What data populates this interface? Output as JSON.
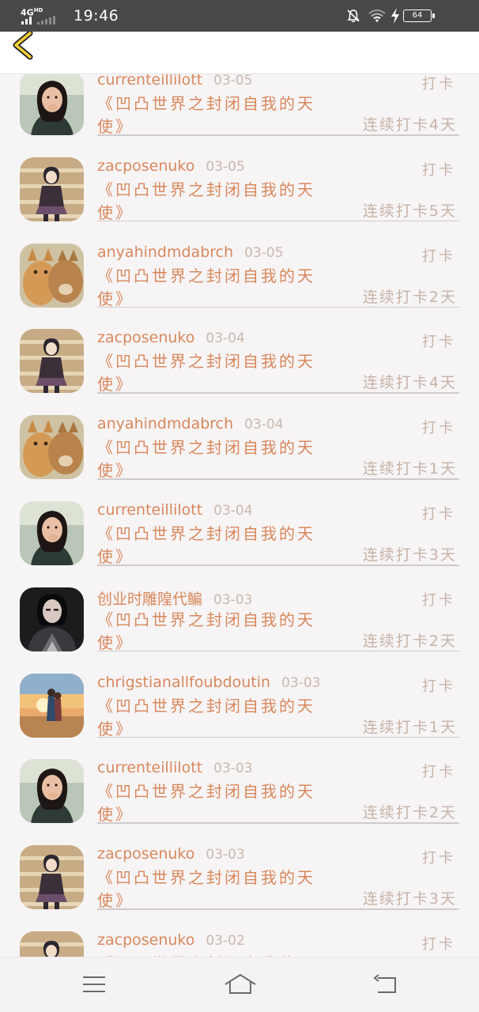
{
  "status_bar": {
    "network": "4G",
    "network_sup": "HD",
    "time": "19:46",
    "battery": "64",
    "icons": [
      "signal-icon",
      "mute-icon",
      "wifi-icon",
      "charging-icon",
      "battery-icon"
    ]
  },
  "header": {
    "back_icon": "chevron-left-icon"
  },
  "list": {
    "items": [
      {
        "name": "currenteillilott",
        "date": "03-05",
        "action": "打卡",
        "title_line1": "《凹凸世界之封闭自我的天",
        "title_line2": "使》",
        "streak": "连续打卡4天",
        "avatar": "girl-photo"
      },
      {
        "name": "zacposenuko",
        "date": "03-05",
        "action": "打卡",
        "title_line1": "《凹凸世界之封闭自我的天",
        "title_line2": "使》",
        "streak": "连续打卡5天",
        "avatar": "anime-stairs"
      },
      {
        "name": "anyahindmdabrch",
        "date": "03-05",
        "action": "打卡",
        "title_line1": "《凹凸世界之封闭自我的天",
        "title_line2": "使》",
        "streak": "连续打卡2天",
        "avatar": "cats-photo"
      },
      {
        "name": "zacposenuko",
        "date": "03-04",
        "action": "打卡",
        "title_line1": "《凹凸世界之封闭自我的天",
        "title_line2": "使》",
        "streak": "连续打卡4天",
        "avatar": "anime-stairs"
      },
      {
        "name": "anyahindmdabrch",
        "date": "03-04",
        "action": "打卡",
        "title_line1": "《凹凸世界之封闭自我的天",
        "title_line2": "使》",
        "streak": "连续打卡1天",
        "avatar": "cats-photo"
      },
      {
        "name": "currenteillilott",
        "date": "03-04",
        "action": "打卡",
        "title_line1": "《凹凸世界之封闭自我的天",
        "title_line2": "使》",
        "streak": "连续打卡3天",
        "avatar": "girl-photo"
      },
      {
        "name": "创业时雕隍代鳊",
        "date": "03-03",
        "action": "打卡",
        "title_line1": "《凹凸世界之封闭自我的天",
        "title_line2": "使》",
        "streak": "连续打卡2天",
        "avatar": "dark-warrior"
      },
      {
        "name": "chrigstianallfoubdoutin",
        "date": "03-03",
        "action": "打卡",
        "title_line1": "《凹凸世界之封闭自我的天",
        "title_line2": "使》",
        "streak": "连续打卡1天",
        "avatar": "sunset-couple"
      },
      {
        "name": "currenteillilott",
        "date": "03-03",
        "action": "打卡",
        "title_line1": "《凹凸世界之封闭自我的天",
        "title_line2": "使》",
        "streak": "连续打卡2天",
        "avatar": "girl-photo"
      },
      {
        "name": "zacposenuko",
        "date": "03-03",
        "action": "打卡",
        "title_line1": "《凹凸世界之封闭自我的天",
        "title_line2": "使》",
        "streak": "连续打卡3天",
        "avatar": "anime-stairs"
      },
      {
        "name": "zacposenuko",
        "date": "03-02",
        "action": "打卡",
        "title_line1": "《凹凸世界之封闭自我的天",
        "title_line2": "",
        "streak": "",
        "avatar": "anime-stairs"
      }
    ]
  },
  "nav_bar": {
    "icons": [
      "menu-icon",
      "home-icon",
      "back-icon"
    ]
  },
  "colors": {
    "accent": "#d8885c",
    "muted": "#c7b3a8",
    "status_bar": "#484848",
    "background": "#f6f4f5"
  }
}
